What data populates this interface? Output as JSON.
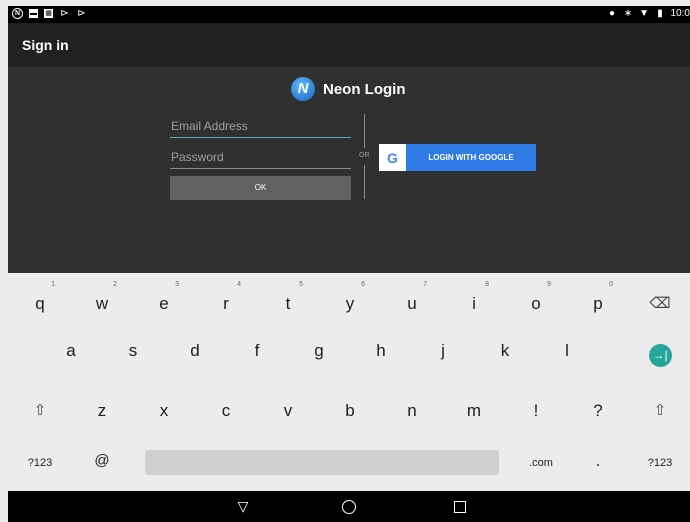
{
  "status_bar": {
    "left_icons": [
      "netflix-icon",
      "image-icon",
      "photo-icon",
      "play-store-icon",
      "play-icon"
    ],
    "right_icons": [
      "location-icon",
      "bluetooth-icon",
      "wifi-icon",
      "battery-icon"
    ],
    "time": "10:0"
  },
  "app_bar": {
    "title": "Sign in"
  },
  "login": {
    "brand": "Neon Login",
    "logo_letter": "N",
    "email_placeholder": "Email Address",
    "password_placeholder": "Password",
    "ok_label": "OK",
    "or_label": "OR",
    "google_label": "LOGIN WITH GOOGLE",
    "google_letter": "G"
  },
  "keyboard": {
    "row1": [
      {
        "label": "q",
        "hint": "1"
      },
      {
        "label": "w",
        "hint": "2"
      },
      {
        "label": "e",
        "hint": "3"
      },
      {
        "label": "r",
        "hint": "4"
      },
      {
        "label": "t",
        "hint": "5"
      },
      {
        "label": "y",
        "hint": "6"
      },
      {
        "label": "u",
        "hint": "7"
      },
      {
        "label": "i",
        "hint": "8"
      },
      {
        "label": "o",
        "hint": "9"
      },
      {
        "label": "p",
        "hint": "0"
      }
    ],
    "row2": [
      "a",
      "s",
      "d",
      "f",
      "g",
      "h",
      "j",
      "k",
      "l"
    ],
    "row3": [
      "z",
      "x",
      "c",
      "v",
      "b",
      "n",
      "m",
      "!",
      "?"
    ],
    "symbols_label": "?123",
    "at_label": "@",
    "com_label": ".com",
    "period_label": ".",
    "backspace_icon": "⌫",
    "enter_icon": "→|",
    "shift_icon": "⇧"
  },
  "nav_bar": {
    "back_icon": "▽"
  },
  "colors": {
    "accent": "#4db6ac",
    "google_blue": "#2f7ae5",
    "enter_teal": "#26a69a"
  }
}
